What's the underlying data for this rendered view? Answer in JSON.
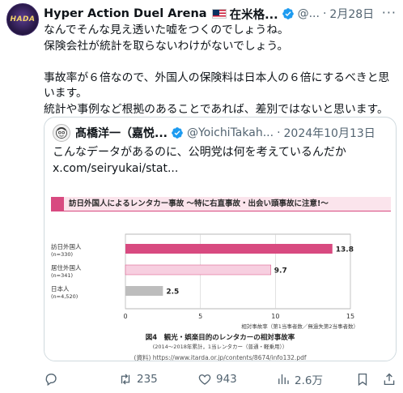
{
  "post": {
    "display_name": "Hyper Action Duel Arena",
    "name_tail": "在米格...",
    "handle": "@...",
    "date": "2月28日",
    "more_label": "···",
    "body_lines": [
      "なんでそんな見え透いた嘘をつくのでしょうね。",
      "保険会社が統計を取らないわけがないでしょう。",
      "",
      "事故率が６倍なので、外国人の保険料は日本人の６倍にするべきと思います。",
      "統計や事例など根拠のあることであれば、差別ではないと思います。"
    ]
  },
  "quote": {
    "name": "髙橋洋一（嘉悦...",
    "handle": "@YoichiTakah...",
    "date": "2024年10月13日",
    "text_lines": [
      "こんなデータがあるのに、公明党は何を考えているんだか",
      "x.com/seiryukai/stat..."
    ],
    "image": {
      "banner_text": "訪日外国人によるレンタカー事故 ～特に右直事故・出会い頭事故に注意!～"
    }
  },
  "chart_data": {
    "type": "bar",
    "orientation": "horizontal",
    "categories": [
      "訪日外国人\n(n=330)",
      "居住外国人\n(n=341)",
      "日本人\n(n=4,520)"
    ],
    "category_labels": [
      [
        "訪日外国人",
        "(n=330)"
      ],
      [
        "居住外国人",
        "(n=341)"
      ],
      [
        "日本人",
        "(n=4,520)"
      ]
    ],
    "values": [
      13.8,
      9.7,
      2.5
    ],
    "value_labels": [
      "13.8",
      "9.7",
      "2.5"
    ],
    "colors": [
      "#d84a80",
      "#f7cfe0",
      "#bdbdbd"
    ],
    "xlim": [
      0,
      15
    ],
    "xticks": [
      "0",
      "5",
      "10",
      "15"
    ],
    "xlabel": "相対事故率（第1当事者数／無過失第2当事者数）",
    "title": "図4　観光・娯楽目的のレンタカーの相対事故率",
    "subtitle": "(2014～2018年累計，1当レンタカー（普通・軽乗用））",
    "source": "(資料) https://www.itarda.or.jp/contents/8674/info132.pdf"
  },
  "actions": {
    "replies": "",
    "reposts": "235",
    "likes": "943",
    "views": "2.6万"
  },
  "icons": {
    "verified": "verified-badge-icon",
    "reply": "reply-icon",
    "repost": "repost-icon",
    "like": "heart-icon",
    "views": "views-icon",
    "bookmark": "bookmark-icon",
    "share": "share-icon"
  },
  "colors": {
    "accent": "#1d9bf0",
    "text": "#0f1419",
    "muted": "#536471"
  }
}
